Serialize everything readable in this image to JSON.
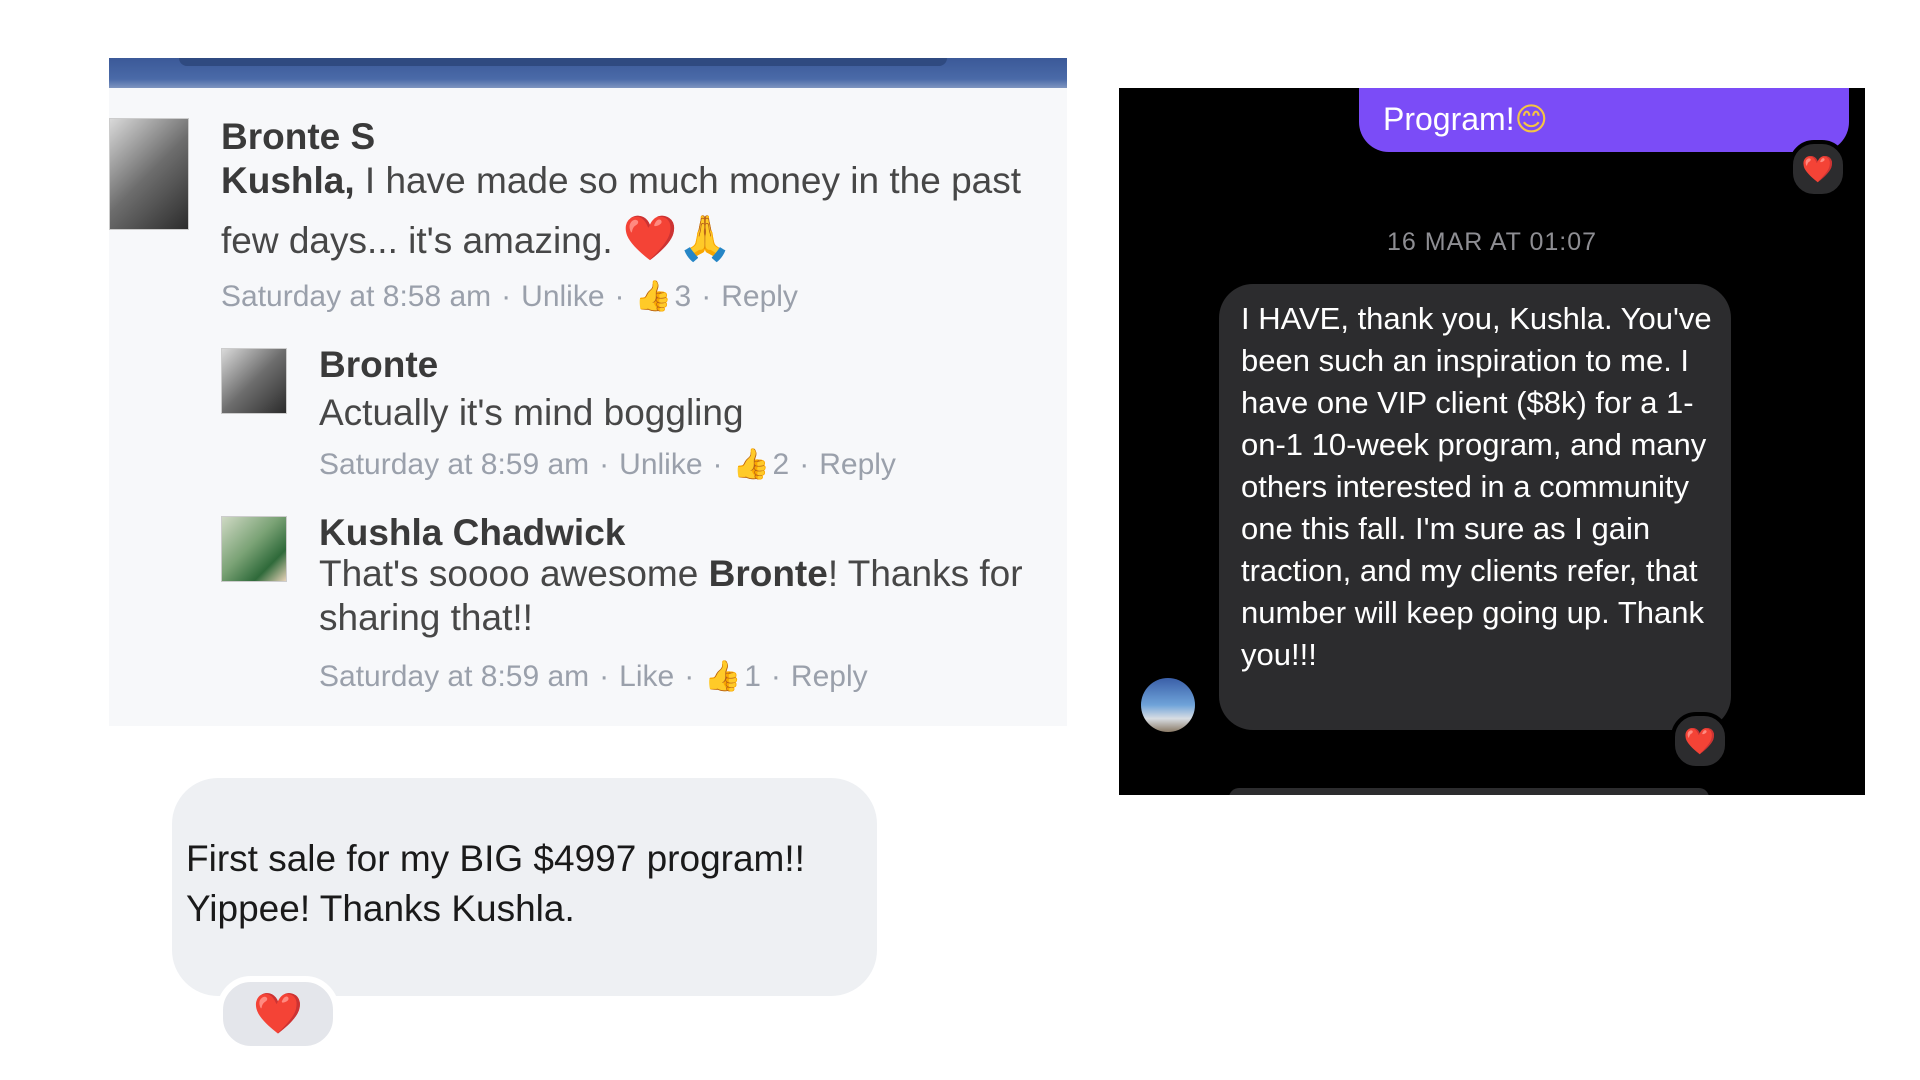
{
  "fb_comments": {
    "comments": [
      {
        "name": "Bronte S",
        "text_strong": "Kushla,",
        "text": " I have made so much money in the past few days... it's amazing.",
        "emoji": "❤️🙏",
        "meta_time": "Saturday at 8:58 am",
        "meta_action": "Unlike",
        "like_count": "3",
        "meta_reply": "Reply"
      },
      {
        "name": "Bronte",
        "text": "Actually it's mind boggling",
        "meta_time": "Saturday at 8:59 am",
        "meta_action": "Unlike",
        "like_count": "2",
        "meta_reply": "Reply"
      },
      {
        "name": "Kushla Chadwick",
        "text_before": "That's soooo awesome ",
        "text_strong": "Bronte",
        "text_after": "! Thanks for sharing that!!",
        "meta_time": "Saturday at 8:59 am",
        "meta_action": "Like",
        "like_count": "1",
        "meta_reply": "Reply"
      }
    ],
    "separator": "·"
  },
  "light_chat": {
    "message": "First sale for my BIG $4997 program!! Yippee! Thanks Kushla.",
    "reaction": "❤️"
  },
  "dark_chat": {
    "prev_message_tail": "Program!",
    "prev_emoji": "😊",
    "prev_reaction": "❤️",
    "timestamp": "16 MAR AT 01:07",
    "message": "I HAVE, thank you, Kushla. You've been such an inspiration to me. I have one VIP client ($8k) for a 1-on-1 10-week program, and many others interested in a community one this fall. I'm sure as I gain traction, and my clients refer, that number will keep going up. Thank you!!!",
    "reaction": "❤️"
  },
  "colors": {
    "fb_blue": "#3b5998",
    "purple_bubble": "#7b4cf7",
    "dark_bubble": "#2c2c2e",
    "heart": "#e0202a"
  }
}
